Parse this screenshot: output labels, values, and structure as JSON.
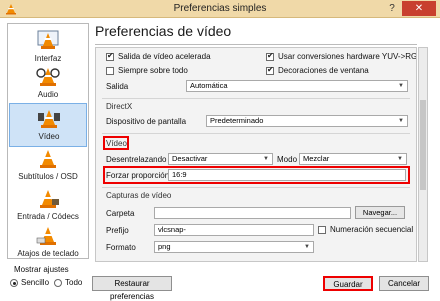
{
  "window": {
    "title": "Preferencias simples",
    "help_glyph": "?",
    "close_glyph": "✕"
  },
  "sidebar": {
    "items": [
      {
        "label": "Interfaz",
        "icon": "interface-cone-icon"
      },
      {
        "label": "Audio",
        "icon": "audio-cone-icon"
      },
      {
        "label": "Vídeo",
        "icon": "video-cone-icon",
        "selected": true
      },
      {
        "label": "Subtítulos / OSD",
        "icon": "subtitles-cone-icon"
      },
      {
        "label": "Entrada / Códecs",
        "icon": "input-cone-icon"
      },
      {
        "label": "Atajos de teclado",
        "icon": "hotkeys-cone-icon"
      }
    ]
  },
  "show_settings": {
    "label": "Mostrar ajustes",
    "simple": "Sencillo",
    "all": "Todo",
    "selected": "simple"
  },
  "main": {
    "title": "Preferencias de vídeo",
    "checks": {
      "accelerated": "Salida de vídeo acelerada",
      "yuv_rgb": "Usar conversiones hardware YUV->RGB",
      "always_on_top": "Siempre sobre todo",
      "window_decorations": "Decoraciones de ventana"
    },
    "output": {
      "label": "Salida",
      "value": "Automática"
    },
    "directx": {
      "title": "DirectX",
      "device_label": "Dispositivo de pantalla",
      "device_value": "Predeterminado"
    },
    "video": {
      "title": "Vídeo",
      "deinterlace_label": "Desentrelazando",
      "deinterlace_value": "Desactivar",
      "mode_label": "Modo",
      "mode_value": "Mezclar",
      "aspect_label": "Forzar proporción",
      "aspect_value": "16:9"
    },
    "captures": {
      "title": "Capturas de vídeo",
      "folder_label": "Carpeta",
      "folder_value": "",
      "browse": "Navegar...",
      "prefix_label": "Prefijo",
      "prefix_value": "vlcsnap-",
      "sequential": "Numeración secuencial",
      "format_label": "Formato",
      "format_value": "png"
    }
  },
  "footer": {
    "reset": "Restaurar preferencias",
    "save": "Guardar",
    "cancel": "Cancelar"
  },
  "colors": {
    "highlight_box": "#ee0000",
    "selection": "#cfe3f7",
    "titlebar": "#f0d9a8"
  }
}
